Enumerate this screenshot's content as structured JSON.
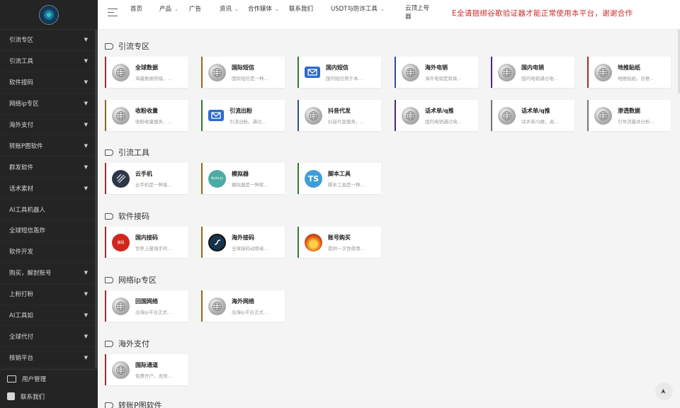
{
  "sidebar": {
    "items": [
      {
        "label": "引流专区",
        "arrow": true
      },
      {
        "label": "引流工具",
        "arrow": true
      },
      {
        "label": "软件接码",
        "arrow": true
      },
      {
        "label": "网络ip专区",
        "arrow": true
      },
      {
        "label": "海外支付",
        "arrow": true
      },
      {
        "label": "转账P图软件",
        "arrow": true
      },
      {
        "label": "群发软件",
        "arrow": true
      },
      {
        "label": "话术素材",
        "arrow": true
      },
      {
        "label": "AI工具机器人",
        "arrow": false
      },
      {
        "label": "全球短信轰炸",
        "arrow": false
      },
      {
        "label": "软件开发",
        "arrow": false
      },
      {
        "label": "购买，解封账号",
        "arrow": true
      },
      {
        "label": "上粉打粉",
        "arrow": true
      },
      {
        "label": "AI工具如",
        "arrow": true
      },
      {
        "label": "全球代付",
        "arrow": true
      },
      {
        "label": "核销平台",
        "arrow": true
      }
    ],
    "footer": [
      {
        "label": "用户管理",
        "icon": "id-card-icon"
      },
      {
        "label": "联系我们",
        "icon": "contact-icon"
      }
    ],
    "arrow_glyph": "▼"
  },
  "topbar": {
    "nav": [
      {
        "label": "首页",
        "caret": false
      },
      {
        "label": "产品",
        "caret": true
      },
      {
        "label": "广告",
        "caret": false
      },
      {
        "label": "资讯",
        "caret": true
      },
      {
        "label": "合作媒体",
        "caret": true
      },
      {
        "label": "联系我们",
        "caret": false
      },
      {
        "label": "USDT与防诈工具",
        "caret": true
      },
      {
        "label": "云顶上号器",
        "caret": false
      }
    ],
    "caret_glyph": "⌄",
    "notice": "E全请捆绑谷歌验证器才能正常使用本平台，谢谢合作"
  },
  "sections": [
    {
      "title": "引流专区",
      "cards": [
        {
          "name": "全球数据",
          "desc": "海量数据存储，…",
          "icon": "globe-icon",
          "color": "#9b3030"
        },
        {
          "name": "国际短信",
          "desc": "国际短信是一种…",
          "icon": "globe-icon",
          "color": "#8a6d1e"
        },
        {
          "name": "国内短信",
          "desc": "国内短信用于本…",
          "icon": "mail-icon",
          "color": "#2e7d32"
        },
        {
          "name": "海外电销",
          "desc": "海外电销是跨境…",
          "icon": "globe-icon",
          "color": "#2f4f8f"
        },
        {
          "name": "国内电销",
          "desc": "国内电销通过电…",
          "icon": "globe-icon",
          "color": "#4b2a7a"
        },
        {
          "name": "地推贴纸",
          "desc": "地推贴纸，创意…",
          "icon": "globe-icon",
          "color": "#9b3030"
        },
        {
          "name": "收粉收量",
          "desc": "收粉收量服务，…",
          "icon": "globe-icon",
          "color": "#8a6d1e"
        },
        {
          "name": "引流出粉",
          "desc": "引流出粉，通过…",
          "icon": "mail-icon",
          "color": "#2e7d32"
        },
        {
          "name": "抖音代发",
          "desc": "抖音代发服务，…",
          "icon": "globe-icon",
          "color": "#2f4f8f"
        },
        {
          "name": "话术单/q推",
          "desc": "国内电销通过电…",
          "icon": "globe-icon",
          "color": "#4b2a7a"
        },
        {
          "name": "话术单/q推",
          "desc": "话术单/Q推，高…",
          "icon": "globe-icon",
          "color": "#777777"
        },
        {
          "name": "渗透数据",
          "desc": "引导流量并分析…",
          "icon": "globe-icon",
          "color": "#777777"
        }
      ]
    },
    {
      "title": "引流工具",
      "cards": [
        {
          "name": "云手机",
          "desc": "云手机是一种基…",
          "icon": "cloud-phone-icon",
          "color": "#9b3030"
        },
        {
          "name": "模拟器",
          "desc": "模拟器是一种软…",
          "icon": "autojs-icon",
          "color": "#8a6d1e"
        },
        {
          "name": "脚本工具",
          "desc": "脚本工具是一种…",
          "icon": "typescript-icon",
          "color": "#2e7d32"
        }
      ]
    },
    {
      "title": "软件接码",
      "cards": [
        {
          "name": "国内接码",
          "desc": "世界上最强手的…",
          "icon": "cn-sms-icon",
          "color": "#9b3030"
        },
        {
          "name": "海外接码",
          "desc": "全球接码动替者…",
          "icon": "sea-sms-icon",
          "color": "#8a6d1e"
        },
        {
          "name": "账号购买",
          "desc": "提供一次性使用…",
          "icon": "fire-icon",
          "color": "#2e7d32"
        }
      ]
    },
    {
      "title": "网络ip专区",
      "cards": [
        {
          "name": "回国网络",
          "desc": "出海ip平台正式…",
          "icon": "globe-icon",
          "color": "#9b3030"
        },
        {
          "name": "海外网络",
          "desc": "出海ip平台正式…",
          "icon": "globe-icon",
          "color": "#8a6d1e"
        }
      ]
    },
    {
      "title": "海外支付",
      "cards": [
        {
          "name": "国际通道",
          "desc": "免费开户，无限…",
          "icon": "globe-icon",
          "color": "#9b3030"
        }
      ]
    },
    {
      "title": "转账P图软件",
      "cards": []
    }
  ],
  "icons": {
    "tag": "tag-icon",
    "menu": "menu-icon",
    "back_to_top": "arrow-up-icon"
  },
  "back_to_top_glyph": "➤"
}
